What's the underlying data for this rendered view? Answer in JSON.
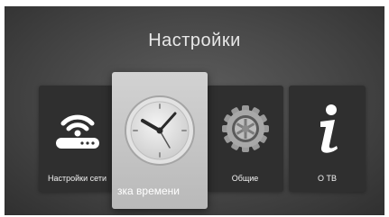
{
  "screen": {
    "title": "Настройки"
  },
  "menu": {
    "items": [
      {
        "label": "Настройки сети",
        "icon": "wifi-router-icon",
        "focused": false
      },
      {
        "label": "зка времени",
        "icon": "clock-icon",
        "focused": true
      },
      {
        "label": "Общие",
        "icon": "gear-icon",
        "focused": false
      },
      {
        "label": "О ТВ",
        "icon": "info-icon",
        "focused": false
      }
    ]
  },
  "colors": {
    "background": "#4a4a4a",
    "tile": "#2f2f2f",
    "focused_tile": "#c8c8c8",
    "text": "#ffffff"
  }
}
